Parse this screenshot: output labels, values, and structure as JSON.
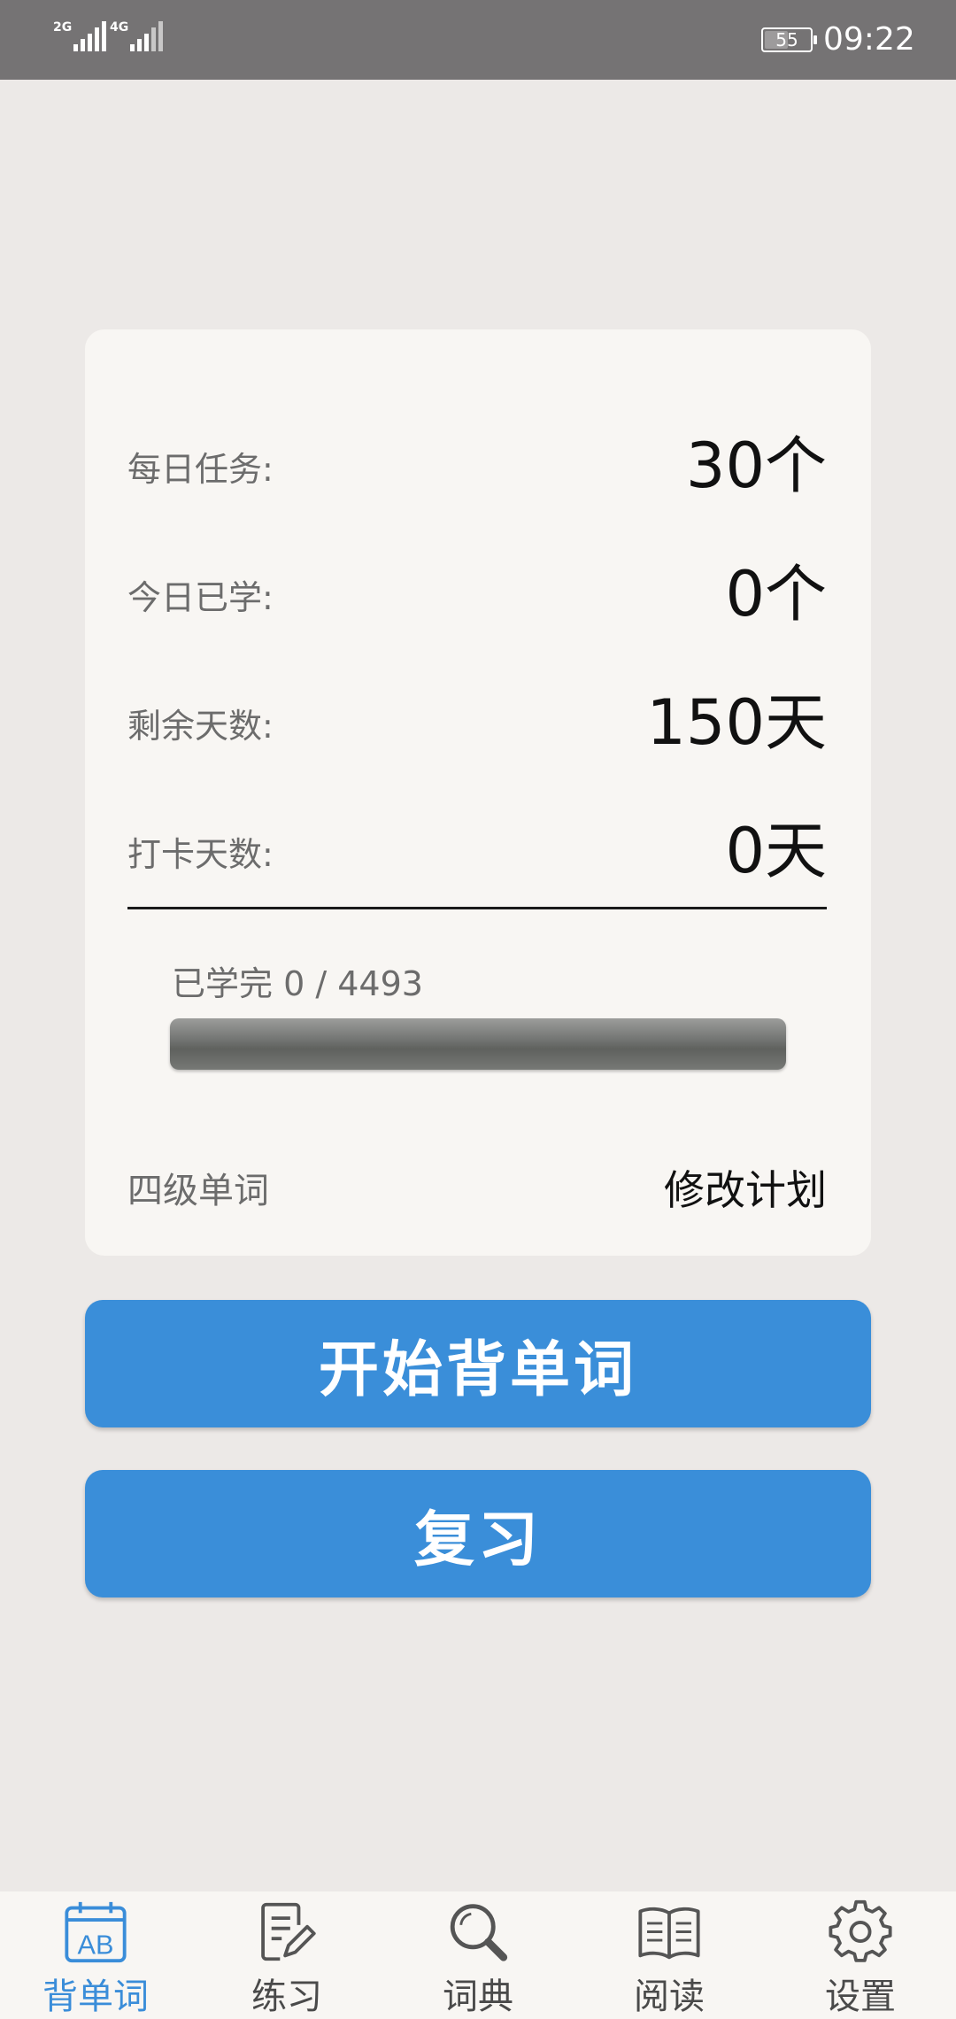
{
  "status_bar": {
    "signal_1": "2G",
    "signal_2": "4G",
    "battery": "55",
    "time": "09:22"
  },
  "plan": {
    "stats": [
      {
        "label": "每日任务:",
        "value": "30个"
      },
      {
        "label": "今日已学:",
        "value": "0个"
      },
      {
        "label": "剩余天数:",
        "value": "150天"
      },
      {
        "label": "打卡天数:",
        "value": "0天"
      }
    ],
    "progress_text": "已学完 0 / 4493",
    "progress_fraction": 0,
    "wordbook": "四级单词",
    "edit_plan": "修改计划"
  },
  "actions": {
    "start": "开始背单词",
    "review": "复习"
  },
  "tabs": [
    {
      "label": "背单词",
      "icon": "calendar-ab-icon",
      "active": true
    },
    {
      "label": "练习",
      "icon": "notepad-pencil-icon",
      "active": false
    },
    {
      "label": "词典",
      "icon": "magnifier-icon",
      "active": false
    },
    {
      "label": "阅读",
      "icon": "open-book-icon",
      "active": false
    },
    {
      "label": "设置",
      "icon": "gear-icon",
      "active": false
    }
  ],
  "colors": {
    "accent": "#3a8dd9",
    "background": "#ece9e7",
    "card": "#f8f6f3",
    "status_bar": "#757374"
  }
}
